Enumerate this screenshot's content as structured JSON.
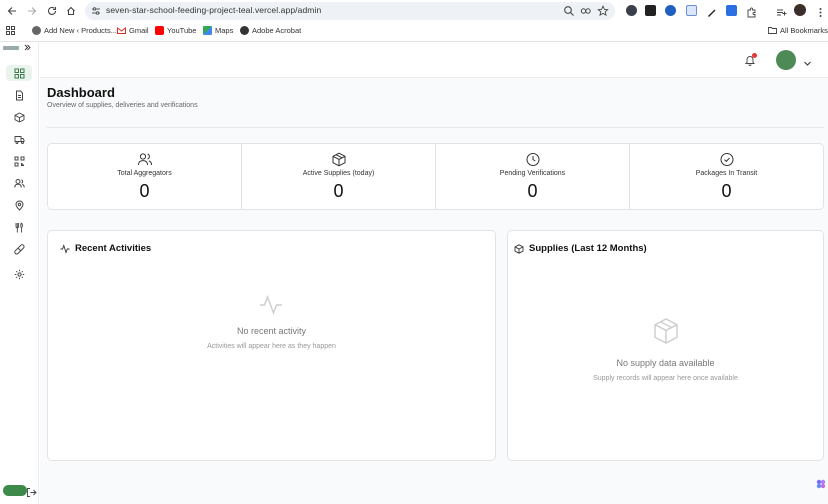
{
  "browser": {
    "url": "seven-star-school-feeding-project-teal.vercel.app/admin",
    "bookmarks": [
      {
        "label": "Add New ‹ Products..."
      },
      {
        "label": "Gmail"
      },
      {
        "label": "YouTube"
      },
      {
        "label": "Maps"
      },
      {
        "label": "Adobe Acrobat"
      }
    ],
    "all_bookmarks": "All Bookmarks"
  },
  "sidebar": {
    "items": [
      {
        "icon": "dashboard-icon",
        "active": true
      },
      {
        "icon": "document-icon"
      },
      {
        "icon": "package-icon"
      },
      {
        "icon": "truck-icon"
      },
      {
        "icon": "qr-code-icon"
      },
      {
        "icon": "users-icon"
      },
      {
        "icon": "map-pin-icon"
      },
      {
        "icon": "utensils-icon"
      },
      {
        "icon": "pill-icon"
      },
      {
        "icon": "settings-icon"
      }
    ],
    "accent": "#3d8a4b"
  },
  "header": {
    "title": "Dashboard",
    "subtitle": "Overview of supplies, deliveries and verifications"
  },
  "stats": [
    {
      "label": "Total Aggregators",
      "value": "0",
      "icon": "users-icon"
    },
    {
      "label": "Active Supplies (today)",
      "value": "0",
      "icon": "package-icon"
    },
    {
      "label": "Pending Verifications",
      "value": "0",
      "icon": "clock-icon"
    },
    {
      "label": "Packages In Transit",
      "value": "0",
      "icon": "check-circle-icon"
    }
  ],
  "recent": {
    "title": "Recent Activities",
    "empty_title": "No recent activity",
    "empty_sub": "Activities will appear here as they happen"
  },
  "supplies": {
    "title": "Supplies (Last 12 Months)",
    "empty_title": "No supply data available",
    "empty_sub": "Supply records will appear here once available"
  }
}
